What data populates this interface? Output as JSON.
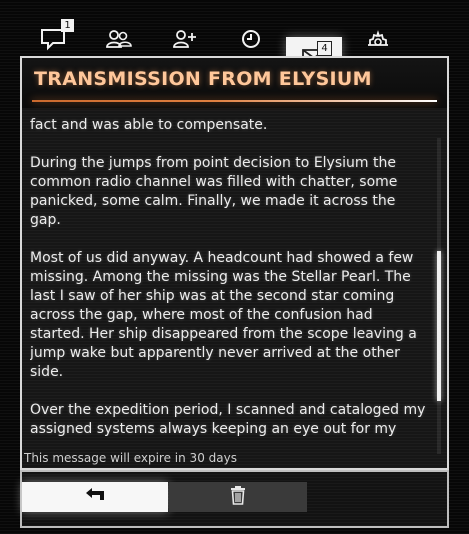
{
  "tabs": [
    {
      "id": "chat",
      "icon": "chat-bubble-icon",
      "badge": "1",
      "active": false
    },
    {
      "id": "contacts",
      "icon": "contacts-icon",
      "badge": "",
      "active": false
    },
    {
      "id": "add-friend",
      "icon": "add-friend-icon",
      "badge": "",
      "active": false
    },
    {
      "id": "history",
      "icon": "clock-icon",
      "badge": "",
      "active": false
    },
    {
      "id": "inbox",
      "icon": "envelope-icon",
      "badge": "4",
      "active": true
    },
    {
      "id": "settings",
      "icon": "gear-icon",
      "badge": "",
      "active": false
    }
  ],
  "message": {
    "title": "TRANSMISSION FROM ELYSIUM",
    "paragraphs": [
      "fact and was able to compensate.",
      "During the jumps from point decision to Elysium the common radio channel was filled with chatter, some panicked, some calm. Finally, we made it across the gap.",
      "Most of us did anyway. A headcount had showed a few missing. Among the missing was the Stellar Pearl. The last I saw of her ship was at the second star coming across the gap, where most of the confusion had started. Her ship disappeared from the scope leaving a jump wake but apparently never arrived at the other side.",
      "Over the expedition period, I scanned and cataloged my assigned systems always keeping an eye out for my friend or any of the others who didn’t come across. They never"
    ],
    "expiry": "This message will expire in 30 days"
  },
  "actions": {
    "reply_icon": "reply-arrow-icon",
    "delete_icon": "trash-icon"
  },
  "colors": {
    "title": "#ffc79a",
    "accent": "#e08040",
    "text": "#ececec",
    "background": "#161616"
  }
}
